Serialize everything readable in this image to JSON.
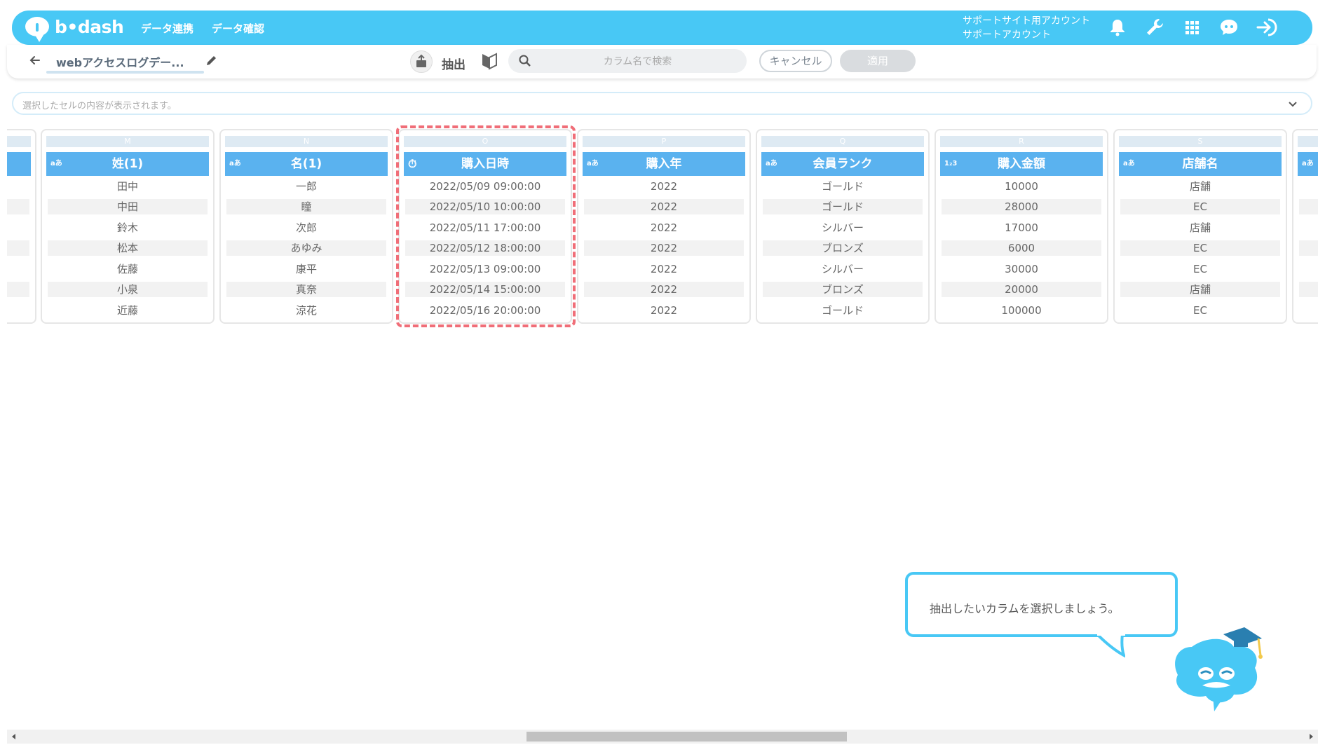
{
  "header": {
    "logo_text": "b•dash",
    "nav": [
      "データ連携",
      "データ確認"
    ],
    "account_line1": "サポートサイト用アカウント",
    "account_line2": "サポートアカウント",
    "icons": [
      "bell-icon",
      "wrench-icon",
      "apps-grid-icon",
      "chat-face-icon",
      "logout-icon"
    ]
  },
  "toolbar": {
    "dataset_name": "webアクセスログデー...",
    "mode_label": "抽出",
    "search_placeholder": "カラム名で検索",
    "cancel_label": "キャンセル",
    "apply_label": "適用"
  },
  "cell_preview": {
    "placeholder": "選択したセルの内容が表示されます。"
  },
  "columns": [
    {
      "letter": "M",
      "name": "姓(1)",
      "type": "aあ",
      "values": [
        "田中",
        "中田",
        "鈴木",
        "松本",
        "佐藤",
        "小泉",
        "近藤"
      ]
    },
    {
      "letter": "N",
      "name": "名(1)",
      "type": "aあ",
      "values": [
        "一郎",
        "瞳",
        "次郎",
        "あゆみ",
        "康平",
        "真奈",
        "涼花"
      ]
    },
    {
      "letter": "O",
      "name": "購入日時",
      "type": "⏱",
      "values": [
        "2022/05/09 09:00:00",
        "2022/05/10 10:00:00",
        "2022/05/11 17:00:00",
        "2022/05/12 18:00:00",
        "2022/05/13 09:00:00",
        "2022/05/14 15:00:00",
        "2022/05/16 20:00:00"
      ]
    },
    {
      "letter": "P",
      "name": "購入年",
      "type": "aあ",
      "values": [
        "2022",
        "2022",
        "2022",
        "2022",
        "2022",
        "2022",
        "2022"
      ]
    },
    {
      "letter": "Q",
      "name": "会員ランク",
      "type": "aあ",
      "values": [
        "ゴールド",
        "ゴールド",
        "シルバー",
        "ブロンズ",
        "シルバー",
        "ブロンズ",
        "ゴールド"
      ]
    },
    {
      "letter": "R",
      "name": "購入金額",
      "type": "1₂3",
      "values": [
        "10000",
        "28000",
        "17000",
        "6000",
        "30000",
        "20000",
        "100000"
      ]
    },
    {
      "letter": "S",
      "name": "店舗名",
      "type": "aあ",
      "values": [
        "店舗",
        "EC",
        "店舗",
        "EC",
        "EC",
        "店舗",
        "EC"
      ]
    }
  ],
  "partial_next_column_type": "aあ",
  "tooltip": {
    "text": "抽出したいカラムを選択しましょう。"
  },
  "colors": {
    "brand": "#48c8f5",
    "header_cell": "#5ab2ef",
    "highlight": "#f06e78"
  }
}
